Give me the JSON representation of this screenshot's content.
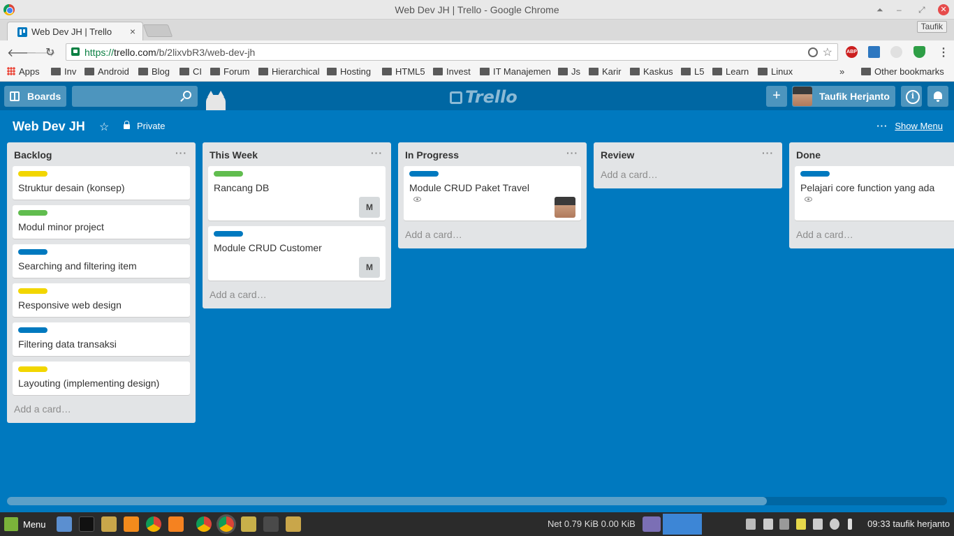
{
  "window": {
    "title": "Web Dev JH | Trello - Google Chrome"
  },
  "tab": {
    "title": "Web Dev JH | Trello",
    "close": "×"
  },
  "profile_button": "Taufik",
  "omnibox": {
    "scheme": "https://",
    "host": "trello.com",
    "path": "/b/2lixvbR3/web-dev-jh"
  },
  "extensions": [
    {
      "name": "adblock-icon",
      "text": "ABP",
      "color": "#cc1f1f"
    }
  ],
  "bookmarks": {
    "apps": "Apps",
    "items": [
      "Inv",
      "Android",
      "Blog",
      "CI",
      "Forum",
      "Hierarchical",
      "Hosting",
      "HTML5",
      "Invest",
      "IT Manajemen",
      "Js",
      "Karir",
      "Kaskus",
      "L5",
      "Learn",
      "Linux"
    ],
    "more": "»",
    "other": "Other bookmarks"
  },
  "trello": {
    "boards_label": "Boards",
    "logo_text": "Trello",
    "user_name": "Taufik Herjanto",
    "add_symbol": "+",
    "board": {
      "name": "Web Dev JH",
      "star": "☆",
      "visibility": "Private",
      "show_menu": "Show Menu",
      "menu_dots": "···"
    },
    "lists": [
      {
        "title": "Backlog",
        "menu": "···",
        "add_card": "Add a card…",
        "cards": [
          {
            "label_color": "#f2d600",
            "text": "Struktur desain (konsep)"
          },
          {
            "label_color": "#61bd4f",
            "text": "Modul minor project"
          },
          {
            "label_color": "#0079bf",
            "text": "Searching and filtering item"
          },
          {
            "label_color": "#f2d600",
            "text": "Responsive web design"
          },
          {
            "label_color": "#0079bf",
            "text": "Filtering data transaksi"
          },
          {
            "label_color": "#f2d600",
            "text": "Layouting (implementing design)"
          }
        ]
      },
      {
        "title": "This Week",
        "menu": "···",
        "add_card": "Add a card…",
        "cards": [
          {
            "label_color": "#61bd4f",
            "text": "Rancang DB",
            "member": "M"
          },
          {
            "label_color": "#0079bf",
            "text": "Module CRUD Customer",
            "member": "M"
          }
        ]
      },
      {
        "title": "In Progress",
        "menu": "···",
        "add_card": "Add a card…",
        "cards": [
          {
            "label_color": "#0079bf",
            "text": "Module CRUD Paket Travel"
          }
        ]
      },
      {
        "title": "Review",
        "menu": "···",
        "add_card": "Add a card…",
        "cards": []
      },
      {
        "title": "Done",
        "menu": "···",
        "add_card": "Add a card…",
        "cards": [
          {
            "label_color": "#0079bf",
            "text": "Pelajari core function yang ada"
          }
        ]
      }
    ]
  },
  "taskbar": {
    "menu_label": "Menu",
    "net": "Net 0.79 KiB 0.00 KiB",
    "clock": "09:33",
    "user": "taufik herjanto"
  }
}
